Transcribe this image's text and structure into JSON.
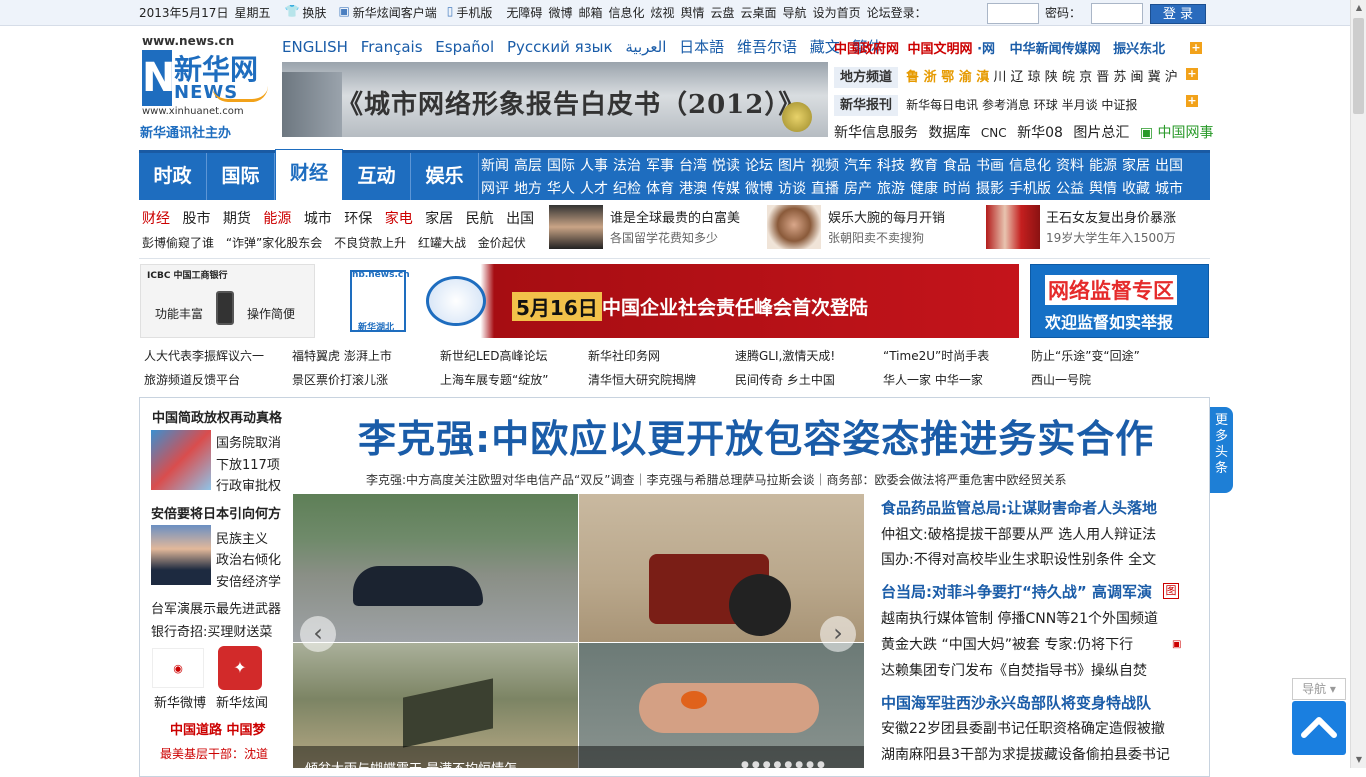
{
  "topbar": {
    "date": "2013年5月17日",
    "weekday": "星期五",
    "skin": "换肤",
    "client": "新华炫闻客户端",
    "mobile": "手机版",
    "links": [
      "无障碍",
      "微博",
      "邮箱",
      "信息化",
      "炫视",
      "舆情",
      "云盘",
      "云桌面",
      "导航",
      "设为首页"
    ],
    "login_label": "论坛登录：",
    "password_label": "密码：",
    "login_button": "登 录"
  },
  "logo": {
    "url_text": "www.news.cn",
    "brand": "新华网",
    "news": "NEWS",
    "domain": "www.xinhuanet.com",
    "org": "新华通讯社主办"
  },
  "languages": [
    "ENGLISH",
    "Français",
    "Español",
    "Русский язык",
    "العربية",
    "日本語",
    "维吾尔语",
    "藏文",
    "繁体"
  ],
  "banner": {
    "title": "《城市网络形象报告白皮书（2012）》"
  },
  "right_links": {
    "row1": [
      "中国政府网",
      "中国文明网",
      "·网",
      "中华新闻传媒网",
      "振兴东北"
    ],
    "row2_label": "地方频道",
    "row2_hot": "鲁 浙 鄂 渝 滇",
    "row2": "川 辽 琼 陕 皖 京 晋 苏 闽 冀 沪",
    "row3_label": "新华报刊",
    "row3": "新华每日电讯 参考消息 环球 半月谈 中证报",
    "row4": [
      "新华信息服务",
      "数据库",
      "CNC",
      "新华08",
      "图片总汇",
      "中国网事"
    ]
  },
  "nav": {
    "tabs": [
      "时政",
      "国际",
      "财经",
      "互动",
      "娱乐"
    ],
    "active_tab": "财经",
    "links_row1": [
      "新闻",
      "高层",
      "国际",
      "人事",
      "法治",
      "军事",
      "台湾",
      "悦读",
      "论坛",
      "图片",
      "视频",
      "汽车",
      "科技",
      "教育",
      "食品",
      "书画",
      "信息化",
      "资料",
      "能源",
      "家居",
      "出国"
    ],
    "links_row2": [
      "网评",
      "地方",
      "华人",
      "人才",
      "纪检",
      "体育",
      "港澳",
      "传媒",
      "微博",
      "访谈",
      "直播",
      "房产",
      "旅游",
      "健康",
      "时尚",
      "摄影",
      "手机版",
      "公益",
      "舆情",
      "收藏",
      "城市"
    ]
  },
  "finance_links": [
    "财经",
    "股市",
    "期货",
    "能源",
    "城市",
    "环保",
    "家电",
    "家居",
    "民航",
    "出国"
  ],
  "finance_red": [
    "财经",
    "能源",
    "家电"
  ],
  "finance_news": [
    "彭博偷窥了谁",
    "“诈弹”家化股东会",
    "不良贷款上升",
    "红罐大战",
    "金价起伏"
  ],
  "promos": [
    {
      "title": "谁是全球最贵的白富美",
      "sub": "各国留学花费知多少"
    },
    {
      "title": "娱乐大腕的每月开销",
      "sub": "张朝阳卖不卖搜狗"
    },
    {
      "title": "王石女友复出身价暴涨",
      "sub": "19岁大学生年入1500万"
    }
  ],
  "ads": {
    "icbc_title": "ICBC 中国工商银行",
    "icbc_left": "功能丰富",
    "icbc_right": "操作简便",
    "center_date": "5月16日",
    "center_text": "中国企业社会责任峰会首次登陆",
    "center_brand": "hb.news.cn",
    "center_sub": "新华湖北",
    "right_line1": "网络监督专区",
    "right_line2": "欢迎监督如实举报"
  },
  "ad_links_row1": [
    "人大代表李振辉议六一",
    "福特翼虎 澎湃上市",
    "新世纪LED高峰论坛",
    "新华社印务网",
    "速腾GLI,激情天成!",
    "“Time2U”时尚手表",
    "防止“乐途”变“回途”"
  ],
  "ad_links_row2": [
    "旅游频道反馈平台",
    "景区票价打滚儿涨",
    "上海车展专题“绽放”",
    "清华恒大研究院揭牌",
    "民间传奇 乡土中国",
    "华人一家 中华一家",
    "西山一号院"
  ],
  "headline": "李克强:中欧应以更开放包容姿态推进务实合作",
  "subheadline": "李克强:中方高度关注欧盟对华电信产品“双反”调查｜李克强与希腊总理萨马拉斯会谈｜商务部：欧委会做法将严重危害中欧经贸关系",
  "left_col": {
    "item1_title": "中国简政放权再动真格",
    "item1_lines": [
      "国务院取消",
      "下放117项",
      "行政审批权"
    ],
    "item2_title": "安倍要将日本引向何方",
    "item2_lines": [
      "民族主义",
      "政治右倾化",
      "安倍经济学"
    ],
    "line3": "台军演展示最先进武器",
    "line4": "银行奇招:买理财送菜",
    "weibo_label": "新华微博",
    "xuanwen_label": "新华炫闻",
    "red_line": "中国道路  中国梦",
    "bottom_line": "最美基层干部：沈道"
  },
  "slider_caption": "倾盆大雨与蝴蝶震天 最满不均恒情怎",
  "right_news": [
    {
      "text": "食品药品监管总局:让谋财害命者人头落地",
      "h": true
    },
    {
      "text": "仲祖文:破格提拔干部要从严  选人用人辩证法",
      "h": false
    },
    {
      "text": "国办:不得对高校毕业生求职设性别条件  全文",
      "h": false
    },
    {
      "text": "台当局:对菲斗争要打“持久战” 高调军演",
      "h": true
    },
    {
      "text": "越南执行媒体管制  停播CNN等21个外国频道",
      "h": false
    },
    {
      "text": "黄金大跌 “中国大妈”被套  专家:仍将下行",
      "h": false
    },
    {
      "text": "达赖集团专门发布《自焚指导书》操纵自焚",
      "h": false
    },
    {
      "text": "中国海军驻西沙永兴岛部队将变身特战队",
      "h": true
    },
    {
      "text": "安徽22岁团县委副书记任职资格确定造假被撤",
      "h": false
    },
    {
      "text": "湖南麻阳县3干部为求提拔藏设备偷拍县委书记",
      "h": false
    }
  ],
  "side_tab": [
    "更",
    "多",
    "头",
    "条"
  ],
  "nav_button": "导航",
  "colors": {
    "blue": "#1e6dbf",
    "link": "#1a5ca8",
    "red": "#c00000",
    "orange": "#f2a21a"
  }
}
